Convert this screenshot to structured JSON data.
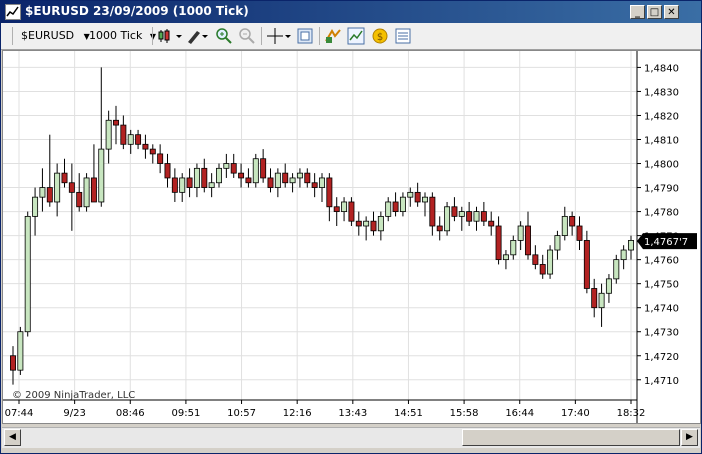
{
  "window": {
    "title": "$EURUSD  23/09/2009 (1000 Tick)"
  },
  "toolbar": {
    "instrument": "$EURUSD",
    "interval": "1000 Tick",
    "icons": [
      "bar-type-icon",
      "drawing-pencil-icon",
      "zoom-in-icon",
      "zoom-out-icon",
      "crosshair-icon",
      "data-box-icon",
      "strategies-icon",
      "indicators-icon",
      "order-icon",
      "properties-icon"
    ]
  },
  "copyright": "© 2009 NinjaTrader, LLC",
  "last_price_label": "1,4767'7",
  "colors": {
    "up": "#c8e6c0",
    "down": "#b22222",
    "wick": "#000000",
    "grid": "#e0e0e0",
    "title_bar": "#0a246a"
  },
  "chart_data": {
    "type": "candlestick",
    "ylim": [
      1.4702,
      1.4846
    ],
    "y_ticks": [
      "1,4710",
      "1,4720",
      "1,4730",
      "1,4740",
      "1,4750",
      "1,4760",
      "1,4770",
      "1,4780",
      "1,4790",
      "1,4800",
      "1,4810",
      "1,4820",
      "1,4830",
      "1,4840"
    ],
    "x_ticks": [
      "07:44",
      "9/23",
      "08:46",
      "09:51",
      "10:57",
      "12:16",
      "13:43",
      "14:51",
      "15:58",
      "16:44",
      "17:40",
      "18:32"
    ],
    "candles": [
      [
        1.472,
        1.4724,
        1.4708,
        1.4714
      ],
      [
        1.4714,
        1.4732,
        1.4712,
        1.473
      ],
      [
        1.473,
        1.478,
        1.4728,
        1.4778
      ],
      [
        1.4778,
        1.479,
        1.477,
        1.4786
      ],
      [
        1.4786,
        1.4798,
        1.478,
        1.479
      ],
      [
        1.479,
        1.4812,
        1.4782,
        1.4784
      ],
      [
        1.4784,
        1.48,
        1.4778,
        1.4796
      ],
      [
        1.4796,
        1.4802,
        1.479,
        1.4792
      ],
      [
        1.4792,
        1.48,
        1.4772,
        1.4788
      ],
      [
        1.4788,
        1.4796,
        1.478,
        1.4782
      ],
      [
        1.4782,
        1.4796,
        1.478,
        1.4794
      ],
      [
        1.4794,
        1.4808,
        1.4784,
        1.4784
      ],
      [
        1.4784,
        1.484,
        1.4782,
        1.4806
      ],
      [
        1.4806,
        1.4822,
        1.48,
        1.4818
      ],
      [
        1.4818,
        1.4824,
        1.4808,
        1.4816
      ],
      [
        1.4816,
        1.482,
        1.4806,
        1.4808
      ],
      [
        1.4808,
        1.4814,
        1.4804,
        1.4812
      ],
      [
        1.4812,
        1.4814,
        1.4806,
        1.4808
      ],
      [
        1.4808,
        1.4812,
        1.4802,
        1.4806
      ],
      [
        1.4806,
        1.4808,
        1.48,
        1.4804
      ],
      [
        1.4804,
        1.4808,
        1.4796,
        1.48
      ],
      [
        1.48,
        1.4804,
        1.479,
        1.4794
      ],
      [
        1.4794,
        1.4798,
        1.4784,
        1.4788
      ],
      [
        1.4788,
        1.4796,
        1.4784,
        1.4794
      ],
      [
        1.4794,
        1.4798,
        1.4786,
        1.479
      ],
      [
        1.479,
        1.48,
        1.4786,
        1.4798
      ],
      [
        1.4798,
        1.4802,
        1.4788,
        1.479
      ],
      [
        1.479,
        1.4796,
        1.4786,
        1.4792
      ],
      [
        1.4792,
        1.48,
        1.479,
        1.4798
      ],
      [
        1.4798,
        1.4804,
        1.4794,
        1.48
      ],
      [
        1.48,
        1.4804,
        1.4794,
        1.4796
      ],
      [
        1.4796,
        1.48,
        1.479,
        1.4794
      ],
      [
        1.4794,
        1.4798,
        1.479,
        1.4792
      ],
      [
        1.4792,
        1.4804,
        1.479,
        1.4802
      ],
      [
        1.4802,
        1.4806,
        1.4792,
        1.4794
      ],
      [
        1.4794,
        1.4798,
        1.4788,
        1.479
      ],
      [
        1.479,
        1.4798,
        1.4786,
        1.4796
      ],
      [
        1.4796,
        1.48,
        1.479,
        1.4792
      ],
      [
        1.4792,
        1.4796,
        1.4788,
        1.4794
      ],
      [
        1.4794,
        1.4798,
        1.479,
        1.4796
      ],
      [
        1.4796,
        1.4798,
        1.479,
        1.4792
      ],
      [
        1.4792,
        1.4796,
        1.4786,
        1.479
      ],
      [
        1.479,
        1.4796,
        1.4784,
        1.4794
      ],
      [
        1.4794,
        1.4796,
        1.4776,
        1.4782
      ],
      [
        1.4782,
        1.4786,
        1.4774,
        1.478
      ],
      [
        1.478,
        1.4786,
        1.4776,
        1.4784
      ],
      [
        1.4784,
        1.4786,
        1.4774,
        1.4776
      ],
      [
        1.4776,
        1.478,
        1.477,
        1.4774
      ],
      [
        1.4774,
        1.4778,
        1.4768,
        1.4776
      ],
      [
        1.4776,
        1.478,
        1.477,
        1.4772
      ],
      [
        1.4772,
        1.478,
        1.4768,
        1.4778
      ],
      [
        1.4778,
        1.4786,
        1.4776,
        1.4784
      ],
      [
        1.4784,
        1.4788,
        1.4778,
        1.478
      ],
      [
        1.478,
        1.4788,
        1.4778,
        1.4786
      ],
      [
        1.4786,
        1.479,
        1.4782,
        1.4788
      ],
      [
        1.4788,
        1.4792,
        1.4782,
        1.4784
      ],
      [
        1.4784,
        1.4788,
        1.4778,
        1.4786
      ],
      [
        1.4786,
        1.4788,
        1.477,
        1.4774
      ],
      [
        1.4774,
        1.4778,
        1.4768,
        1.4772
      ],
      [
        1.4772,
        1.4784,
        1.477,
        1.4782
      ],
      [
        1.4782,
        1.4786,
        1.4776,
        1.4778
      ],
      [
        1.4778,
        1.4782,
        1.4772,
        1.478
      ],
      [
        1.478,
        1.4784,
        1.4774,
        1.4776
      ],
      [
        1.4776,
        1.4782,
        1.4772,
        1.478
      ],
      [
        1.478,
        1.4784,
        1.4774,
        1.4776
      ],
      [
        1.4776,
        1.478,
        1.477,
        1.4774
      ],
      [
        1.4774,
        1.4778,
        1.4758,
        1.476
      ],
      [
        1.476,
        1.4764,
        1.4756,
        1.4762
      ],
      [
        1.4762,
        1.477,
        1.476,
        1.4768
      ],
      [
        1.4768,
        1.4776,
        1.4764,
        1.4774
      ],
      [
        1.4774,
        1.478,
        1.476,
        1.4762
      ],
      [
        1.4762,
        1.4766,
        1.4756,
        1.4758
      ],
      [
        1.4758,
        1.4762,
        1.4752,
        1.4754
      ],
      [
        1.4754,
        1.4766,
        1.4752,
        1.4764
      ],
      [
        1.4764,
        1.4772,
        1.476,
        1.477
      ],
      [
        1.477,
        1.4782,
        1.4768,
        1.4778
      ],
      [
        1.4778,
        1.478,
        1.477,
        1.4774
      ],
      [
        1.4774,
        1.4778,
        1.4764,
        1.4768
      ],
      [
        1.4768,
        1.4772,
        1.4746,
        1.4748
      ],
      [
        1.4748,
        1.4752,
        1.4736,
        1.474
      ],
      [
        1.474,
        1.475,
        1.4732,
        1.4746
      ],
      [
        1.4746,
        1.4754,
        1.4742,
        1.4752
      ],
      [
        1.4752,
        1.4762,
        1.475,
        1.476
      ],
      [
        1.476,
        1.4766,
        1.4756,
        1.4764
      ],
      [
        1.4764,
        1.477,
        1.476,
        1.4768
      ]
    ]
  }
}
